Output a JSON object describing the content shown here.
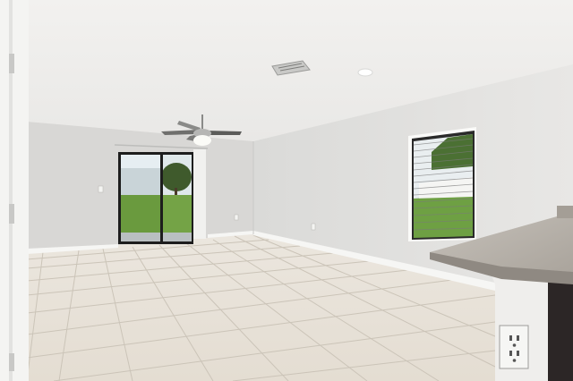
{
  "scene": {
    "description_icons": [
      "ceiling-fan-icon",
      "air-vent-icon",
      "recessed-light-icon",
      "power-outlet-icon"
    ],
    "colors": {
      "ceiling": "#f0efed",
      "back_wall": "#d9d8d6",
      "right_wall": "#e3e2e0",
      "floor_tile": "#e9e4dc",
      "grout": "#cfc9bf",
      "baseboard": "#f7f7f5",
      "grass": "#6ea043",
      "countertop": "#b9b3ab",
      "cabinet": "#2c2626",
      "door_frame": "#ffffff"
    }
  }
}
